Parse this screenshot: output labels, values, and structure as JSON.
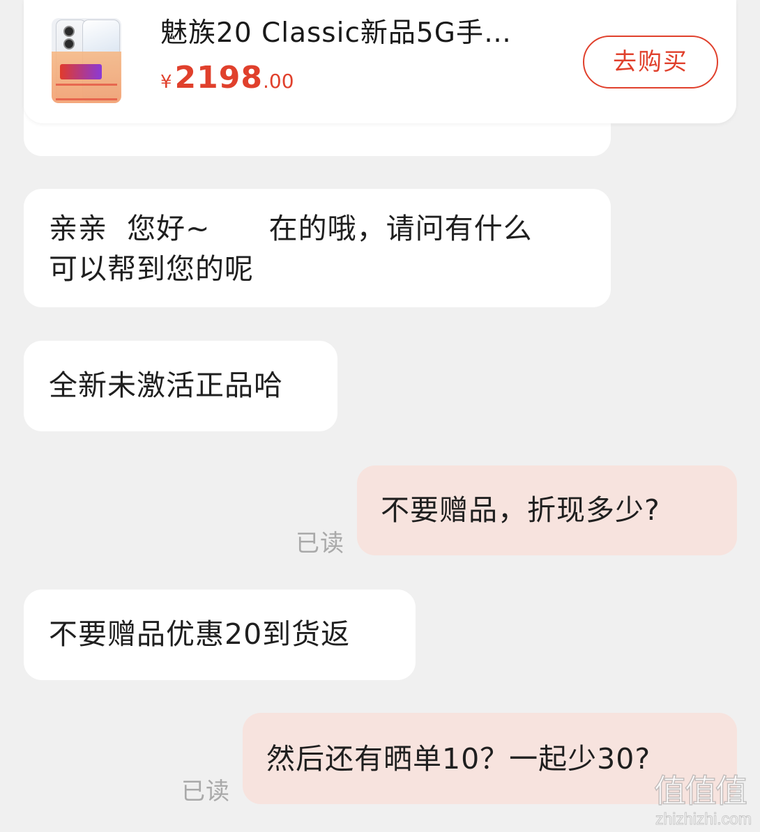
{
  "product": {
    "title": "魅族20 Classic新品5G手…",
    "price_currency": "¥",
    "price_integer": "2198",
    "price_decimal": ".00",
    "buy_label": "去购买",
    "thumbnail_icon": "phone-product-thumbnail",
    "accent_color": "#e0402c"
  },
  "messages": [
    {
      "side": "seller",
      "lines": [
        "亲亲  您好~      在的哦，请问有什么",
        "可以帮到您的呢"
      ]
    },
    {
      "side": "seller",
      "text": "全新未激活正品哈"
    },
    {
      "side": "buyer",
      "text": "不要赠品，折现多少?",
      "status": "已读"
    },
    {
      "side": "seller",
      "text": "不要赠品优惠20到货返"
    },
    {
      "side": "buyer",
      "text": "然后还有晒单10？一起少30?",
      "status": "已读"
    }
  ],
  "watermark": {
    "glyphs": "值值值",
    "domain": "zhizhizhi.com"
  },
  "colors": {
    "background": "#f0f0f0",
    "incoming_bubble": "#ffffff",
    "outgoing_bubble": "#f7e3de",
    "read_status": "#a9a9a9"
  }
}
